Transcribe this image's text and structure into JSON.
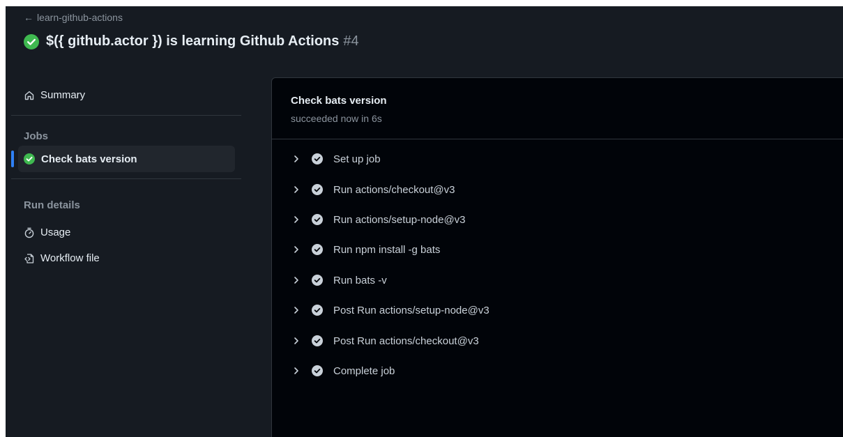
{
  "header": {
    "back_label": "learn-github-actions",
    "back_arrow": "←",
    "title": "$({ github.actor }) is learning Github Actions",
    "run_number": "#4",
    "status_icon": "check-circle-icon",
    "success_color": "#3fb950"
  },
  "sidebar": {
    "summary_label": "Summary",
    "jobs_heading": "Jobs",
    "active_job_label": "Check bats version",
    "run_details_heading": "Run details",
    "usage_label": "Usage",
    "workflow_file_label": "Workflow file",
    "accent_color": "#2f81f7"
  },
  "job": {
    "title": "Check bats version",
    "status": "succeeded now in 6s",
    "steps": [
      {
        "label": "Set up job"
      },
      {
        "label": "Run actions/checkout@v3"
      },
      {
        "label": "Run actions/setup-node@v3"
      },
      {
        "label": "Run npm install -g bats"
      },
      {
        "label": "Run bats -v"
      },
      {
        "label": "Post Run actions/setup-node@v3"
      },
      {
        "label": "Post Run actions/checkout@v3"
      },
      {
        "label": "Complete job"
      }
    ]
  }
}
